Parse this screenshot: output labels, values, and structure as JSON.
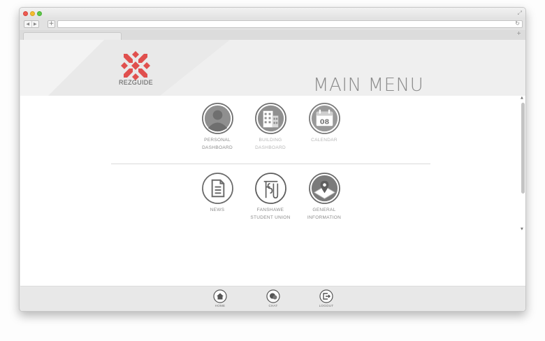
{
  "brand": {
    "logo_text": "REZGUIDE",
    "accent_color": "#e0504e"
  },
  "header": {
    "title": "MAIN MENU"
  },
  "menu_top": [
    {
      "label": "PERSONAL\nDASHBOARD",
      "icon": "person-icon"
    },
    {
      "label": "BUILDING\nDASHBOARD",
      "icon": "building-icon"
    },
    {
      "label": "CALENDAR",
      "icon": "calendar-icon",
      "calendar_day": "08"
    }
  ],
  "menu_bottom": [
    {
      "label": "NEWS",
      "icon": "document-icon"
    },
    {
      "label": "FANSHAWE\nSTUDENT UNION",
      "icon": "fsu-icon"
    },
    {
      "label": "GENERAL\nINFORMATION",
      "icon": "map-pin-icon"
    }
  ],
  "footer": {
    "home_label": "HOME",
    "chat_label": "CHAT",
    "logout_label": "LOGOUT"
  }
}
